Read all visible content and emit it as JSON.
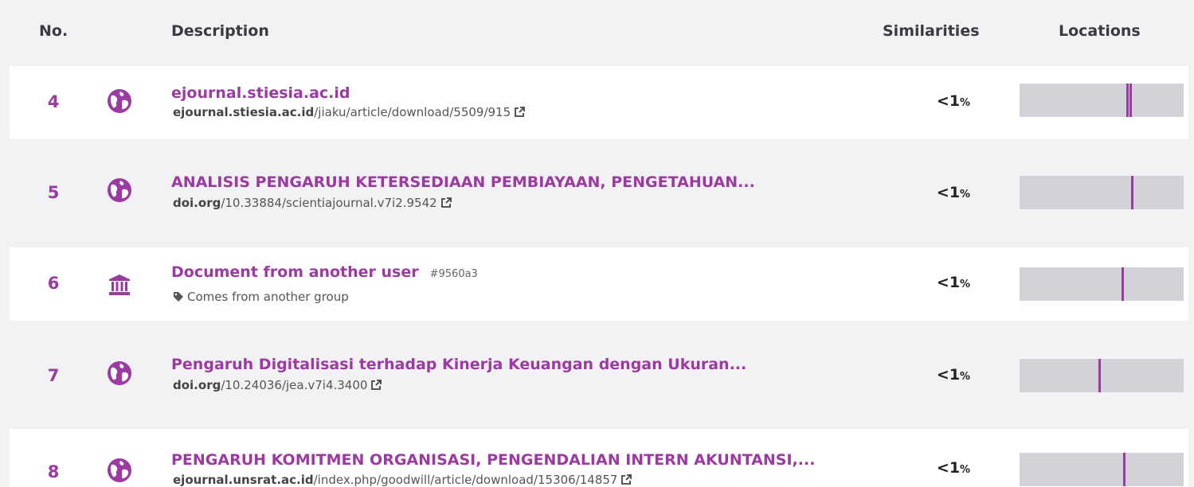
{
  "header": {
    "no": "No.",
    "description": "Description",
    "similarities": "Similarities",
    "locations": "Locations"
  },
  "accent_color": "#9b3aa0",
  "rows": [
    {
      "number": "4",
      "icon": "globe-icon",
      "title": "ejournal.stiesia.ac.id",
      "source_domain": "ejournal.stiesia.ac.id",
      "source_path": "/jiaku/article/download/5509/915",
      "similarity_value": "<1",
      "similarity_unit": "%",
      "location_marks": [
        0.65,
        0.67
      ]
    },
    {
      "number": "5",
      "icon": "globe-icon",
      "title": "ANALISIS PENGARUH KETERSEDIAAN PEMBIAYAAN, PENGETAHUAN...",
      "source_domain": "doi.org",
      "source_path": "/10.33884/scientiajournal.v7i2.9542",
      "similarity_value": "<1",
      "similarity_unit": "%",
      "location_marks": [
        0.68
      ]
    },
    {
      "number": "6",
      "icon": "institution-icon",
      "title": "Document from another user",
      "hash": "#9560a3",
      "group_note": "Comes from another group",
      "similarity_value": "<1",
      "similarity_unit": "%",
      "location_marks": [
        0.62
      ]
    },
    {
      "number": "7",
      "icon": "globe-icon",
      "title": "Pengaruh Digitalisasi terhadap Kinerja Keuangan dengan Ukuran...",
      "source_domain": "doi.org",
      "source_path": "/10.24036/jea.v7i4.3400",
      "similarity_value": "<1",
      "similarity_unit": "%",
      "location_marks": [
        0.48
      ]
    },
    {
      "number": "8",
      "icon": "globe-icon",
      "title": "PENGARUH KOMITMEN ORGANISASI, PENGENDALIAN INTERN AKUNTANSI,...",
      "source_domain": "ejournal.unsrat.ac.id",
      "source_path": "/index.php/goodwill/article/download/15306/14857",
      "similarity_value": "<1",
      "similarity_unit": "%",
      "location_marks": [
        0.63
      ]
    }
  ]
}
